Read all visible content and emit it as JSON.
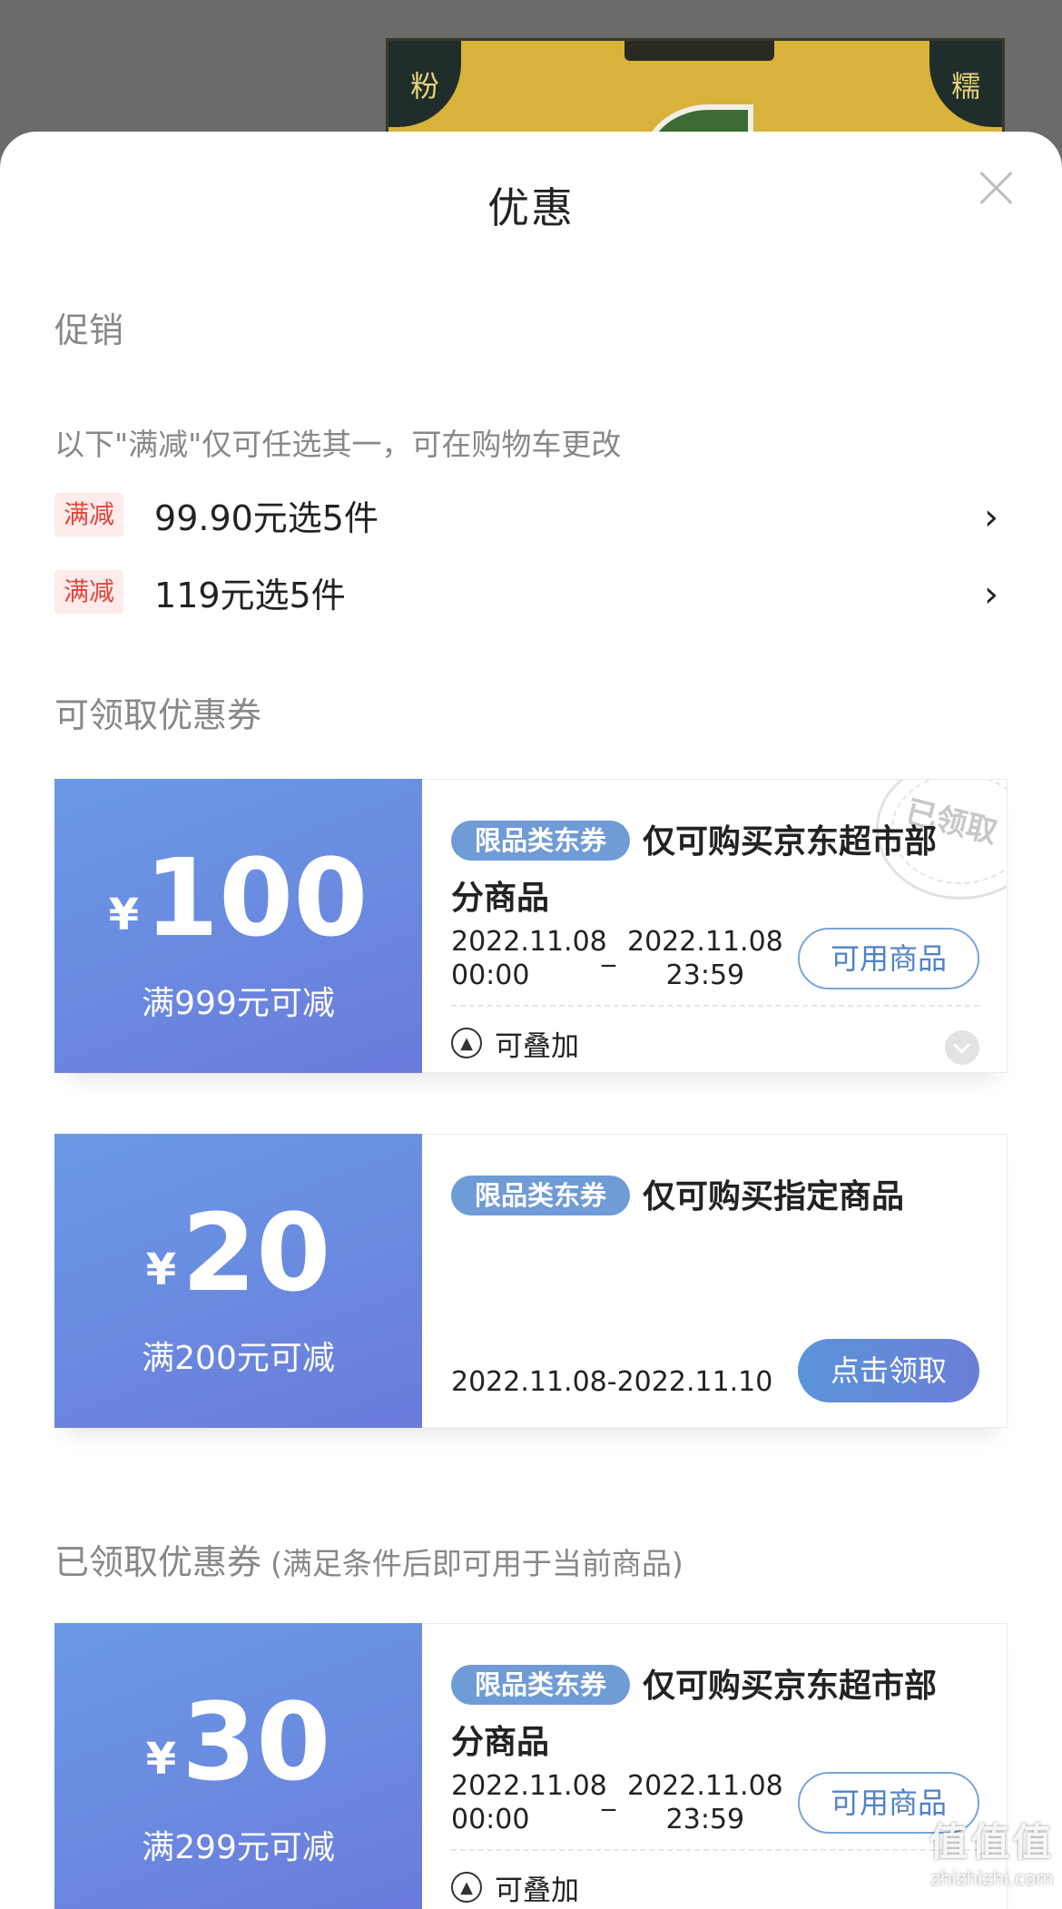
{
  "background": {
    "product_corner_left": "粉",
    "product_corner_right": "糯"
  },
  "sheet": {
    "title": "优惠",
    "close_icon": "close-icon"
  },
  "promotions": {
    "heading": "促销",
    "note": "以下\"满减\"仅可任选其一，可在购物车更改",
    "items": [
      {
        "tag": "满减",
        "text": "99.90元选5件",
        "chevron": "›"
      },
      {
        "tag": "满减",
        "text": "119元选5件",
        "chevron": "›"
      }
    ]
  },
  "available_coupons": {
    "heading": "可领取优惠券",
    "items": [
      {
        "currency": "¥",
        "amount": "100",
        "condition": "满999元可减",
        "type_badge": "限品类东券",
        "title": "仅可购买京东超市部分商品",
        "start_date": "2022.11.08",
        "start_time": "00:00",
        "end_date": "2022.11.08",
        "end_time": "23:59",
        "dash": "_",
        "button": "可用商品",
        "stamp": "已领取",
        "stack_label": "可叠加"
      },
      {
        "currency": "¥",
        "amount": "20",
        "condition": "满200元可减",
        "type_badge": "限品类东券",
        "title": "仅可购买指定商品",
        "date_range": "2022.11.08-2022.11.10",
        "button": "点击领取"
      }
    ]
  },
  "claimed_coupons": {
    "heading": "已领取优惠券",
    "subheading": "(满足条件后即可用于当前商品)",
    "items": [
      {
        "currency": "¥",
        "amount": "30",
        "condition": "满299元可减",
        "type_badge": "限品类东券",
        "title": "仅可购买京东超市部分商品",
        "start_date": "2022.11.08",
        "start_time": "00:00",
        "end_date": "2022.11.08",
        "end_time": "23:59",
        "dash": "_",
        "button": "可用商品",
        "stack_label": "可叠加"
      }
    ]
  },
  "watermark": {
    "mark": "值值值",
    "domain": "zhizhizhi.com"
  }
}
